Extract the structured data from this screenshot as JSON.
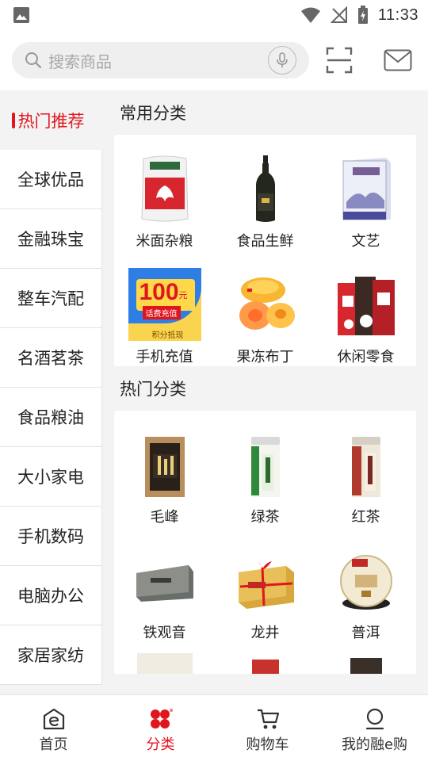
{
  "status_bar": {
    "time": "11:33"
  },
  "search": {
    "placeholder": "搜索商品"
  },
  "sidebar": {
    "items": [
      {
        "label": "热门推荐",
        "active": true
      },
      {
        "label": "全球优品"
      },
      {
        "label": "金融珠宝"
      },
      {
        "label": "整车汽配"
      },
      {
        "label": "名酒茗茶"
      },
      {
        "label": "食品粮油"
      },
      {
        "label": "大小家电"
      },
      {
        "label": "手机数码"
      },
      {
        "label": "电脑办公"
      },
      {
        "label": "家居家纺"
      }
    ]
  },
  "common": {
    "title": "常用分类",
    "items": [
      {
        "label": "米面杂粮",
        "icon": "rice-bag-image"
      },
      {
        "label": "食品生鲜",
        "icon": "oil-bottle-image"
      },
      {
        "label": "文艺",
        "icon": "book-box-image"
      },
      {
        "label": "手机充值",
        "icon": "recharge-card-image",
        "badge_amount": "100",
        "badge_unit": "元",
        "badge_text": "话费充值",
        "badge_sub": "积分抵现"
      },
      {
        "label": "果冻布丁",
        "icon": "jelly-image"
      },
      {
        "label": "休闲零食",
        "icon": "snack-image"
      }
    ]
  },
  "hot": {
    "title": "热门分类",
    "items": [
      {
        "label": "毛峰",
        "icon": "maofeng-tea-bag-image"
      },
      {
        "label": "绿茶",
        "icon": "green-tea-can-image"
      },
      {
        "label": "红茶",
        "icon": "black-tea-can-image"
      },
      {
        "label": "铁观音",
        "icon": "tieguanyin-box-image"
      },
      {
        "label": "龙井",
        "icon": "longjing-package-image"
      },
      {
        "label": "普洱",
        "icon": "puer-cake-image"
      }
    ]
  },
  "bottom_nav": [
    {
      "label": "首页"
    },
    {
      "label": "分类",
      "active": true
    },
    {
      "label": "购物车"
    },
    {
      "label": "我的融e购"
    }
  ],
  "colors": {
    "accent": "#e0161e",
    "background": "#f3f3f3"
  }
}
